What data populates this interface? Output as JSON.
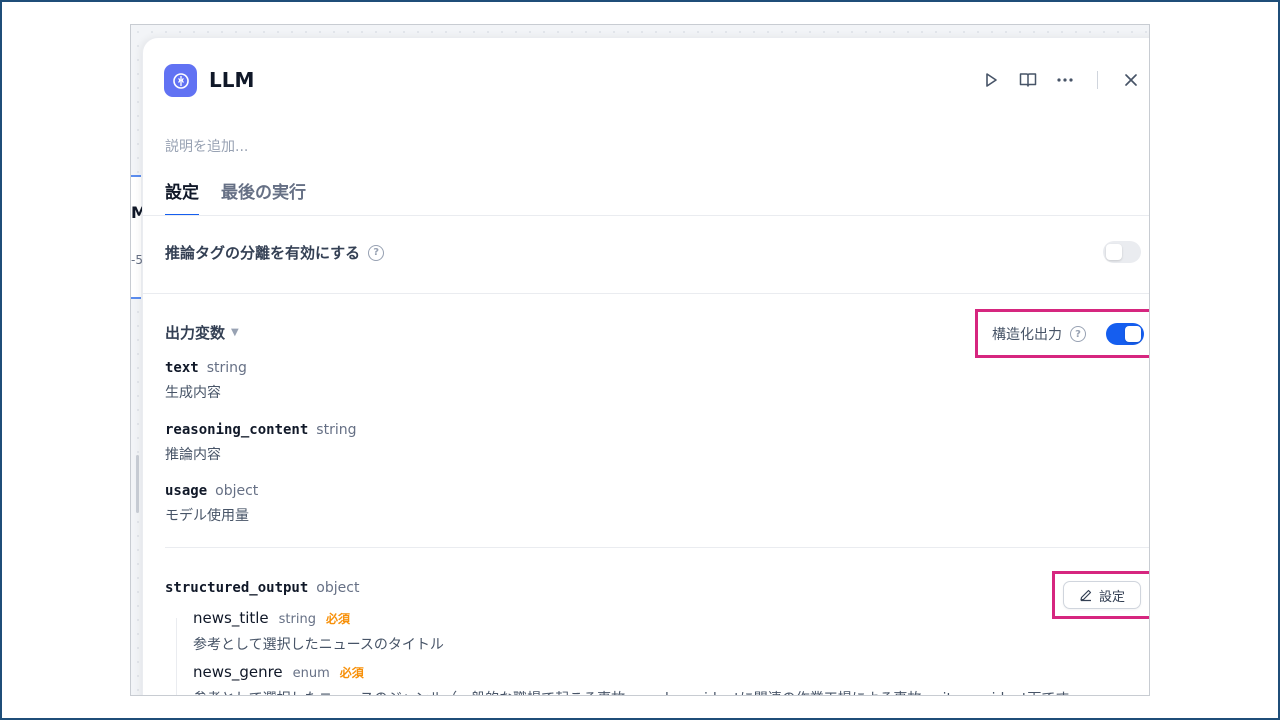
{
  "node": {
    "title": "LLM",
    "description_placeholder": "説明を追加..."
  },
  "header_icons": [
    "play-icon",
    "book-icon",
    "more-icon",
    "close-icon"
  ],
  "tabs": [
    {
      "label": "設定",
      "active": true
    },
    {
      "label": "最後の実行",
      "active": false
    }
  ],
  "reasoning": {
    "label": "推論タグの分離を有効にする",
    "enabled": false
  },
  "output": {
    "title": "出力変数",
    "structured_label": "構造化出力",
    "structured_enabled": true,
    "variables": [
      {
        "name": "text",
        "type": "string",
        "description": "生成内容"
      },
      {
        "name": "reasoning_content",
        "type": "string",
        "description": "推論内容"
      },
      {
        "name": "usage",
        "type": "object",
        "description": "モデル使用量"
      }
    ],
    "structured": {
      "name": "structured_output",
      "type": "object",
      "settings_label": "設定",
      "fields": [
        {
          "name": "news_title",
          "type": "string",
          "required": "必須",
          "description": "参考として選択したニュースのタイトル"
        },
        {
          "name": "news_genre",
          "type": "enum",
          "required": "必須",
          "description": "参考として選択したニュースのジャンル（一般的な職場で起こる事故、work_accidentに関連の作業工場による事故、site_accident下です"
        }
      ]
    }
  },
  "bg_node": {
    "letter": "M",
    "dash": "-5"
  },
  "colors": {
    "accent": "#155eef",
    "highlight": "#d6267f",
    "node_icon": "#6172f3",
    "required": "#f79009"
  }
}
